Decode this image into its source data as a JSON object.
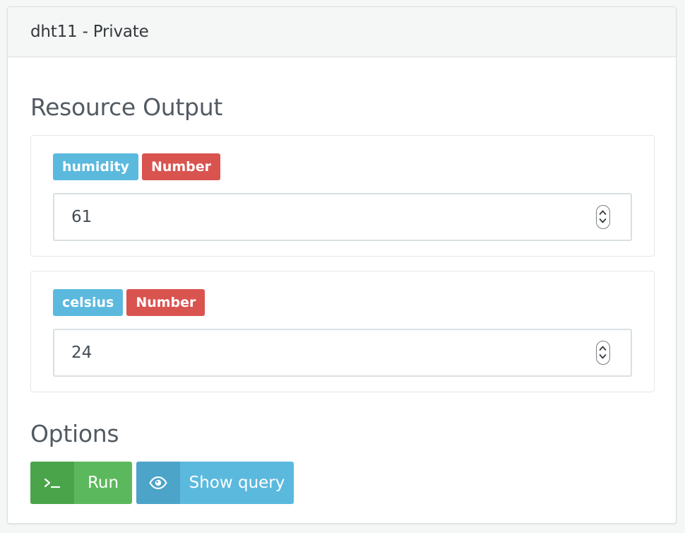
{
  "panel": {
    "title": "dht11 - Private"
  },
  "resource_output": {
    "heading": "Resource Output",
    "fields": [
      {
        "name": "humidity",
        "type": "Number",
        "value": "61"
      },
      {
        "name": "celsius",
        "type": "Number",
        "value": "24"
      }
    ]
  },
  "options": {
    "heading": "Options",
    "run_label": "Run",
    "run_icon": "terminal-icon",
    "show_query_label": "Show query",
    "show_query_icon": "eye-icon"
  },
  "colors": {
    "info": "#5bb9de",
    "danger": "#d9534f",
    "success": "#5cb85c"
  }
}
